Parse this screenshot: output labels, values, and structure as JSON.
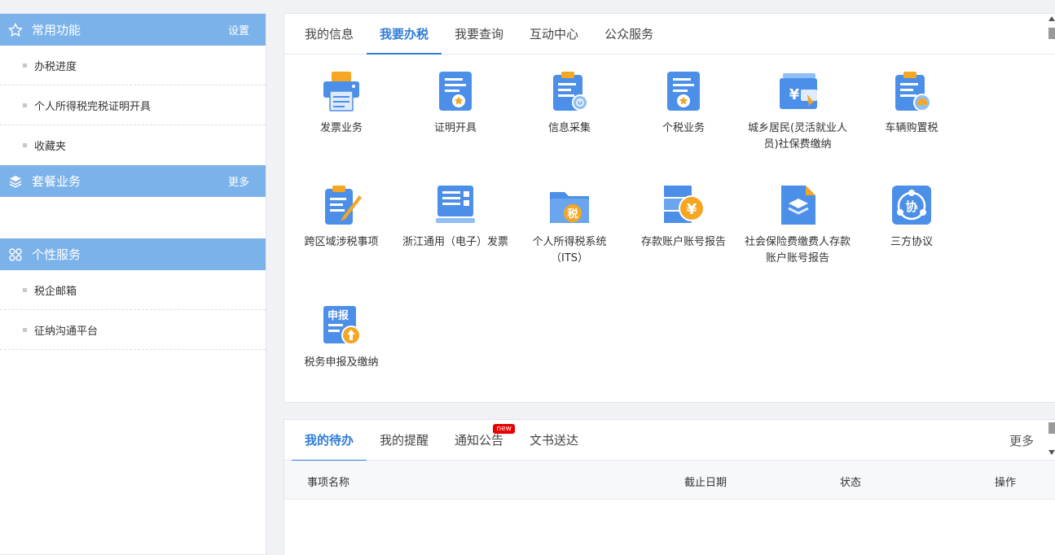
{
  "sidebar": {
    "common": {
      "title": "常用功能",
      "action": "设置",
      "items": [
        "办税进度",
        "个人所得税完税证明开具",
        "收藏夹"
      ]
    },
    "package": {
      "title": "套餐业务",
      "action": "更多"
    },
    "personal": {
      "title": "个性服务",
      "items": [
        "税企邮箱",
        "征纳沟通平台"
      ]
    }
  },
  "top_tabs": [
    "我的信息",
    "我要办税",
    "我要查询",
    "互动中心",
    "公众服务"
  ],
  "active_top_tab": "我要办税",
  "tiles": [
    {
      "label": "发票业务",
      "icon": "printer-icon"
    },
    {
      "label": "证明开具",
      "icon": "certificate-icon"
    },
    {
      "label": "信息采集",
      "icon": "clipboard-icon"
    },
    {
      "label": "个税业务",
      "icon": "personal-tax-icon"
    },
    {
      "label": "城乡居民(灵活就业人员)社保费缴纳",
      "icon": "yuan-wallet-icon"
    },
    {
      "label": "车辆购置税",
      "icon": "vehicle-tax-icon"
    },
    {
      "label": "跨区域涉税事项",
      "icon": "clipboard-pen-icon"
    },
    {
      "label": "浙江通用（电子）发票",
      "icon": "monitor-invoice-icon"
    },
    {
      "label": "个人所得税系统（ITS）",
      "icon": "tax-folder-icon"
    },
    {
      "label": "存款账户账号报告",
      "icon": "deposit-account-icon"
    },
    {
      "label": "社会保险费缴费人存款账户账号报告",
      "icon": "layers-document-icon"
    },
    {
      "label": "三方协议",
      "icon": "agreement-icon"
    },
    {
      "label": "税务申报及缴纳",
      "icon": "declare-pay-icon"
    }
  ],
  "bottom_tabs": [
    "我的待办",
    "我的提醒",
    "通知公告",
    "文书送达"
  ],
  "active_bottom_tab": "我的待办",
  "new_badge": "new",
  "bottom_more": "更多",
  "table_headers": {
    "name": "事项名称",
    "deadline": "截止日期",
    "status": "状态",
    "action": "操作"
  },
  "colors": {
    "sidebar_header": "#7cb2ea",
    "accent": "#2f7cd6",
    "icon_blue": "#4c8fe8",
    "icon_orange": "#f5a623"
  }
}
